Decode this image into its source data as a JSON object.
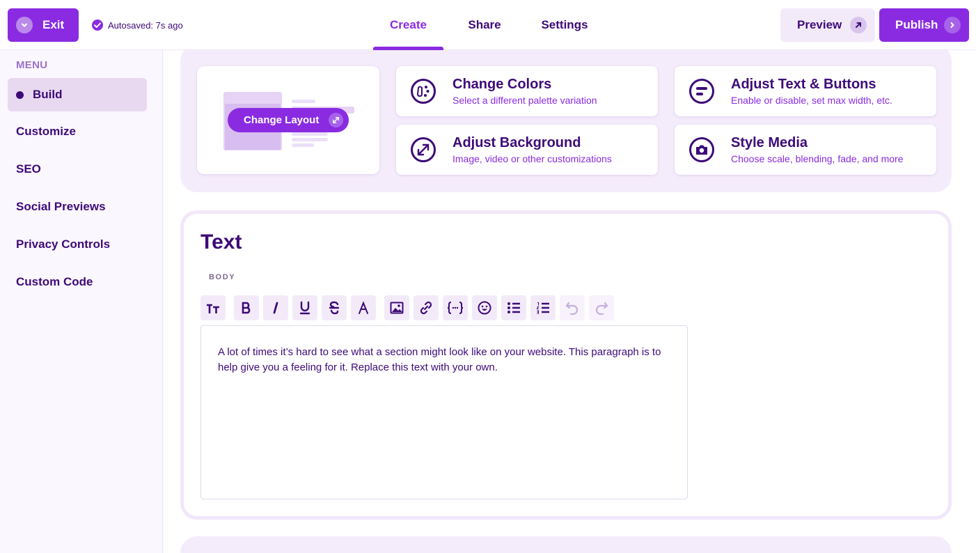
{
  "topbar": {
    "exit_label": "Exit",
    "autosave_text": "Autosaved: 7s ago",
    "tabs": [
      {
        "label": "Create",
        "active": true
      },
      {
        "label": "Share",
        "active": false
      },
      {
        "label": "Settings",
        "active": false
      }
    ],
    "preview_label": "Preview",
    "publish_label": "Publish"
  },
  "sidebar": {
    "menu_label": "MENU",
    "items": [
      {
        "label": "Build",
        "active": true
      },
      {
        "label": "Customize",
        "active": false
      },
      {
        "label": "SEO",
        "active": false
      },
      {
        "label": "Social Previews",
        "active": false
      },
      {
        "label": "Privacy Controls",
        "active": false
      },
      {
        "label": "Custom Code",
        "active": false
      }
    ]
  },
  "options": {
    "change_layout_label": "Change Layout",
    "cards": [
      {
        "title": "Change Colors",
        "desc": "Select a different palette variation",
        "icon": "palette-icon"
      },
      {
        "title": "Adjust Text & Buttons",
        "desc": "Enable or disable, set max width, etc.",
        "icon": "text-buttons-icon"
      },
      {
        "title": "Adjust Background",
        "desc": "Image, video or other customizations",
        "icon": "expand-icon"
      },
      {
        "title": "Style Media",
        "desc": "Choose scale, blending, fade, and more",
        "icon": "camera-icon"
      }
    ]
  },
  "text_section": {
    "title": "Text",
    "body_label": "BODY",
    "toolbar": [
      "text-size-icon",
      "bold-icon",
      "italic-icon",
      "underline-icon",
      "strikethrough-icon",
      "font-color-icon",
      "image-icon",
      "link-icon",
      "variable-icon",
      "emoji-icon",
      "bullet-list-icon",
      "numbered-list-icon",
      "undo-icon",
      "redo-icon"
    ],
    "body_text": "A lot of times it’s hard to see what a section might look like on your website. This paragraph is to help give you a feeling for it. Replace this text with your own."
  },
  "colors": {
    "accent": "#8a2be2",
    "text": "#3d0a78",
    "panel": "#f4ecfb"
  }
}
